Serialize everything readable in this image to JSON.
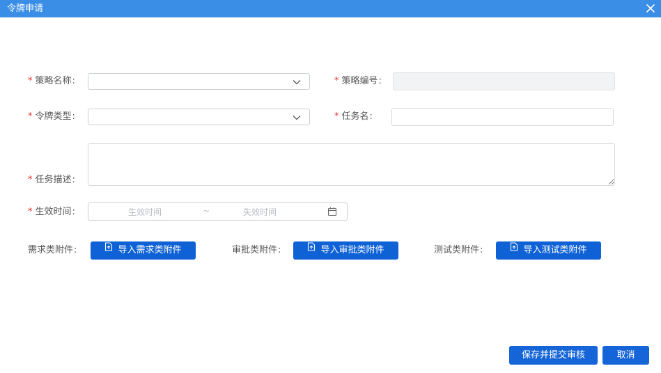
{
  "dialog": {
    "title": "令牌申请"
  },
  "form": {
    "strategy_name": {
      "label": "策略名称",
      "value": ""
    },
    "strategy_code": {
      "label": "策略编号",
      "value": ""
    },
    "token_type": {
      "label": "令牌类型",
      "value": ""
    },
    "task_name": {
      "label": "任务名",
      "value": ""
    },
    "task_desc": {
      "label": "任务描述",
      "value": ""
    },
    "effective_time": {
      "label": "生效时间",
      "start_placeholder": "生效时间",
      "separator": "~",
      "end_placeholder": "失效时间"
    },
    "colon": ":",
    "required_mark": "*"
  },
  "attachments": [
    {
      "label": "需求类附件",
      "button": "导入需求类附件"
    },
    {
      "label": "审批类附件",
      "button": "导入审批类附件"
    },
    {
      "label": "测试类附件",
      "button": "导入测试类附件"
    }
  ],
  "footer": {
    "save_submit": "保存并提交审核",
    "cancel": "取消"
  },
  "colors": {
    "titlebar": "#3a8ee6",
    "primary_button": "#0f62d6",
    "required": "#e53935"
  }
}
